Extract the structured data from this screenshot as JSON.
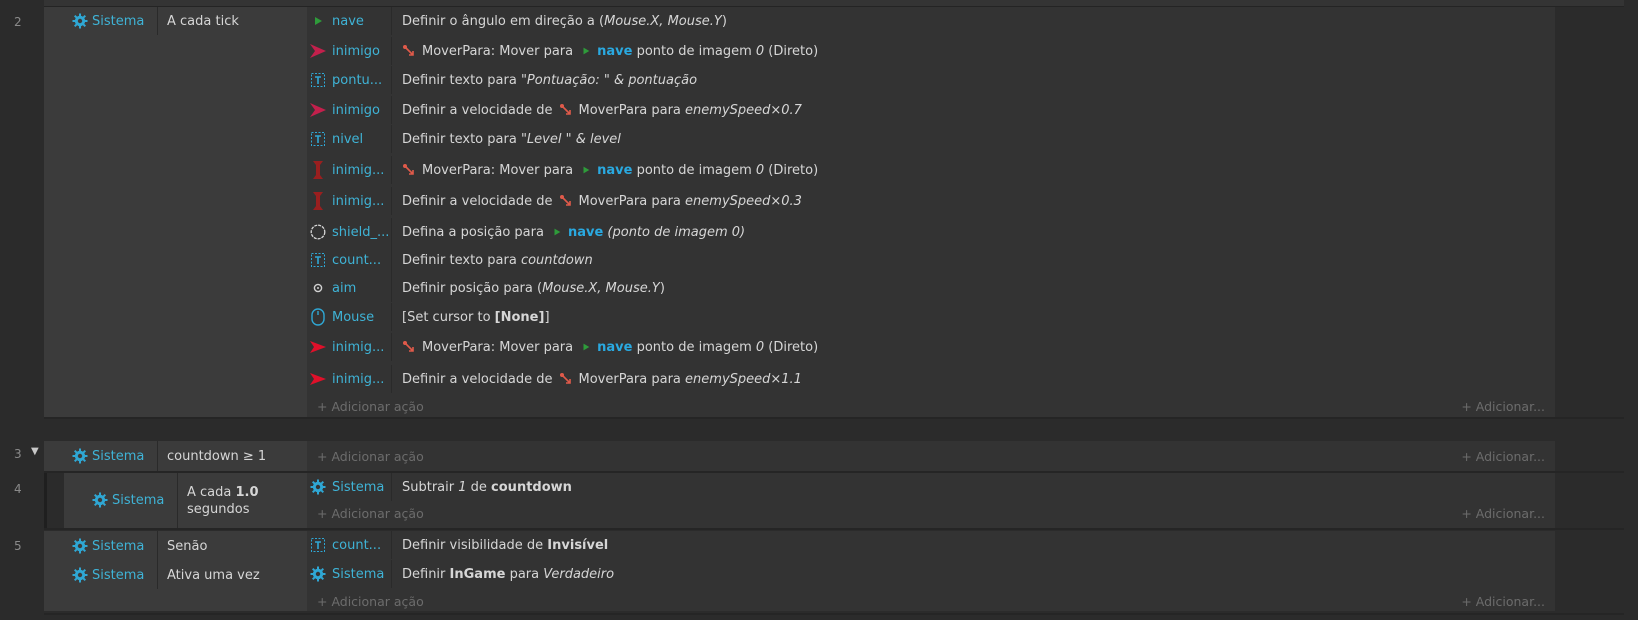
{
  "events": [
    {
      "number": "2",
      "conditions": [
        {
          "object": "Sistema",
          "text": "A cada tick"
        }
      ],
      "actions": [
        {
          "object": "nave",
          "icon": "ship-icon"
        },
        {
          "object": "inimigo",
          "icon": "enemy-arrow-icon"
        },
        {
          "object": "pontu...",
          "icon": "text-icon"
        },
        {
          "object": "inimigo",
          "icon": "enemy-arrow-icon"
        },
        {
          "object": "nivel",
          "icon": "text-icon"
        },
        {
          "object": "inimig...",
          "icon": "enemy-tall-icon"
        },
        {
          "object": "inimig...",
          "icon": "enemy-tall-icon"
        },
        {
          "object": "shield_...",
          "icon": "shield-circle-icon"
        },
        {
          "object": "count...",
          "icon": "text-icon"
        },
        {
          "object": "aim",
          "icon": "crosshair-icon"
        },
        {
          "object": "Mouse",
          "icon": "mouse-icon"
        },
        {
          "object": "inimig...",
          "icon": "enemy-red-arrow-icon"
        },
        {
          "object": "inimig...",
          "icon": "enemy-red-arrow-icon"
        }
      ],
      "action_texts": {
        "a0": {
          "t1": "Definir o ângulo em direção a (",
          "t2": "Mouse.X, Mouse.Y",
          "t3": ")"
        },
        "a1": {
          "t1": "MoverPara: Mover para",
          "t2": "nave",
          "t3": " ponto de imagem ",
          "t4": "0",
          "t5": " (Direto)"
        },
        "a2": {
          "t1": "Definir texto para ",
          "t2": "\"Pontuação: \" & pontuação"
        },
        "a3": {
          "t1": "Definir a velocidade de",
          "t2": "MoverPara para ",
          "t3": "enemySpeed×0.7"
        },
        "a4": {
          "t1": "Definir texto para ",
          "t2": "\"Level \" & level"
        },
        "a5": {
          "t1": "MoverPara: Mover para",
          "t2": "nave",
          "t3": " ponto de imagem ",
          "t4": "0",
          "t5": " (Direto)"
        },
        "a6": {
          "t1": "Definir a velocidade de",
          "t2": "MoverPara para ",
          "t3": "enemySpeed×0.3"
        },
        "a7": {
          "t1": "Defina a posição para",
          "t2": "nave",
          "t3": " (ponto de imagem 0)"
        },
        "a8": {
          "t1": "Definir texto para ",
          "t2": "countdown"
        },
        "a9": {
          "t1": "Definir posição para (",
          "t2": "Mouse.X, Mouse.Y",
          "t3": ")"
        },
        "a10": {
          "t1": "[Set cursor to ",
          "t2": "[None]",
          "t3": "]"
        },
        "a11": {
          "t1": "MoverPara: Mover para",
          "t2": "nave",
          "t3": " ponto de imagem ",
          "t4": "0",
          "t5": " (Direto)"
        },
        "a12": {
          "t1": "Definir a velocidade de",
          "t2": "MoverPara para ",
          "t3": "enemySpeed×1.1"
        }
      }
    },
    {
      "number": "3",
      "conditions": [
        {
          "object": "Sistema",
          "text": "countdown ≥ 1"
        }
      ]
    },
    {
      "number": "4",
      "conditions": [
        {
          "object": "Sistema",
          "text1": "A cada ",
          "text2": "1.0",
          "text3": "segundos"
        }
      ],
      "actions": [
        {
          "object": "Sistema",
          "t1": "Subtrair ",
          "t2": "1",
          "t3": " de ",
          "t4": "countdown"
        }
      ]
    },
    {
      "number": "5",
      "conditions": [
        {
          "object": "Sistema",
          "text": "Senão"
        },
        {
          "object": "Sistema",
          "text": "Ativa uma vez"
        }
      ],
      "actions": [
        {
          "object": "count...",
          "t1": "Definir visibilidade de ",
          "t2": "Invisível"
        },
        {
          "object": "Sistema",
          "t1": "Definir ",
          "t2": "InGame",
          "t3": " para ",
          "t4": "Verdadeiro"
        }
      ]
    }
  ],
  "labels": {
    "add_action": "+ Adicionar ação",
    "add_right": "+ Adicionar..."
  },
  "colors": {
    "object_name": "#3fb3d6",
    "highlight": "#2aa9e0",
    "background": "#2b2b2b",
    "condition_bg": "#3b3b3b",
    "action_bg": "#333333"
  }
}
